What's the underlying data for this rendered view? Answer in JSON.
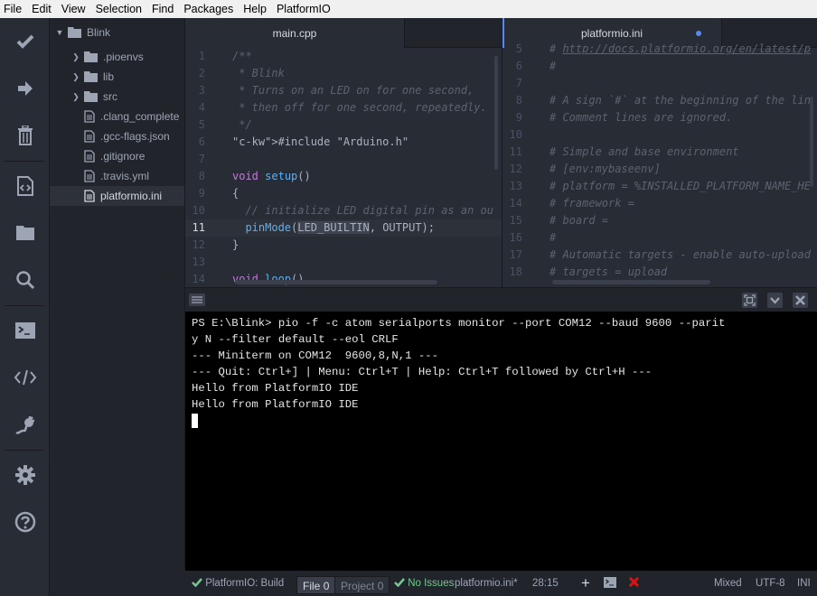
{
  "menu": [
    "File",
    "Edit",
    "View",
    "Selection",
    "Find",
    "Packages",
    "Help",
    "PlatformIO"
  ],
  "toolbar": [
    {
      "name": "build-icon",
      "title": "Build"
    },
    {
      "name": "upload-icon",
      "title": "Upload"
    },
    {
      "name": "clean-icon",
      "title": "Clean"
    },
    {
      "name": "target-icon",
      "title": "Run other target"
    },
    {
      "name": "open-project-icon",
      "title": "Open Project"
    },
    {
      "name": "find-icon",
      "title": "Find in project"
    },
    {
      "name": "terminal-icon",
      "title": "Terminal"
    },
    {
      "name": "serial-monitor-icon",
      "title": "Serial Monitor"
    },
    {
      "name": "plug-icon",
      "title": "Serial Ports"
    },
    {
      "name": "settings-icon",
      "title": "Settings"
    },
    {
      "name": "help-icon",
      "title": "Help"
    }
  ],
  "tree": {
    "root": "Blink",
    "items": [
      {
        "label": ".pioenvs",
        "type": "folder"
      },
      {
        "label": "lib",
        "type": "folder"
      },
      {
        "label": "src",
        "type": "folder"
      },
      {
        "label": ".clang_complete",
        "type": "file"
      },
      {
        "label": ".gcc-flags.json",
        "type": "file"
      },
      {
        "label": ".gitignore",
        "type": "file"
      },
      {
        "label": ".travis.yml",
        "type": "file"
      },
      {
        "label": "platformio.ini",
        "type": "file",
        "selected": true
      }
    ]
  },
  "editors": {
    "left": {
      "tab": "main.cpp",
      "line_numbers": [
        "1",
        "2",
        "3",
        "4",
        "5",
        "6",
        "7",
        "8",
        "9",
        "10",
        "11",
        "12",
        "13",
        "14"
      ],
      "current_line": "11",
      "lines": [
        "/**",
        " * Blink",
        " * Turns on an LED on for one second,",
        " * then off for one second, repeatedly.",
        " */",
        "#include \"Arduino.h\"",
        "",
        "void setup()",
        "{",
        "  // initialize LED digital pin as an ou",
        "  pinMode(LED_BUILTIN, OUTPUT);",
        "}",
        "",
        "void loop()"
      ]
    },
    "right": {
      "tab": "platformio.ini",
      "modified": true,
      "line_numbers": [
        "5",
        "6",
        "7",
        "8",
        "9",
        "10",
        "11",
        "12",
        "13",
        "14",
        "15",
        "16",
        "17",
        "18"
      ],
      "lines": [
        "# http://docs.platformio.org/en/latest/p",
        "#",
        "",
        "# A sign `#` at the beginning of the lin",
        "# Comment lines are ignored.",
        "",
        "# Simple and base environment",
        "# [env:mybaseenv]",
        "# platform = %INSTALLED_PLATFORM_NAME_HE",
        "# framework =",
        "# board =",
        "#",
        "# Automatic targets - enable auto-upload",
        "# targets = upload"
      ]
    }
  },
  "terminal": {
    "lines": [
      "PS E:\\Blink> pio -f -c atom serialports monitor --port COM12 --baud 9600 --parit",
      "y N --filter default --eol CRLF",
      "--- Miniterm on COM12  9600,8,N,1 ---",
      "--- Quit: Ctrl+] | Menu: Ctrl+T | Help: Ctrl+T followed by Ctrl+H ---",
      "Hello from PlatformIO IDE",
      "Hello from PlatformIO IDE"
    ]
  },
  "statusbar": {
    "build": "PlatformIO: Build",
    "file_label": "File",
    "file_count": "0",
    "project_label": "Project",
    "project_count": "0",
    "issues": "No Issues",
    "filename": "platformio.ini*",
    "cursor": "28:15",
    "line_ending": "Mixed",
    "encoding": "UTF-8",
    "grammar": "INI"
  },
  "colors": {
    "accent": "#568af2",
    "success": "#73c990",
    "error": "#e01010"
  }
}
